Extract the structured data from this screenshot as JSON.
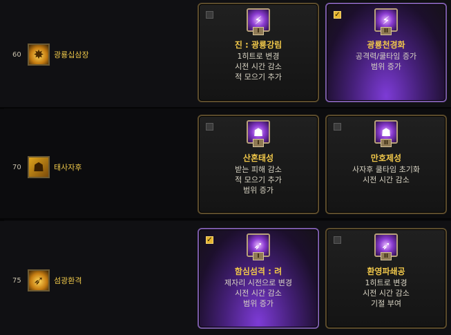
{
  "rows": [
    {
      "level": "60",
      "skill_name": "광룡십삼장",
      "skill_icon": "fire-dragon-fist-icon",
      "tripods": [
        {
          "checked": false,
          "roman": "I",
          "name": "진 : 광룡강림",
          "desc": [
            "1히트로 변경",
            "시전 시간 감소",
            "적 모으기 추가"
          ],
          "icon": "lightning-burst-icon"
        },
        {
          "checked": true,
          "roman": "II",
          "name": "광룡천경화",
          "desc": [
            "공격력/쿨타임 증가",
            "범위 증가"
          ],
          "icon": "lightning-burst-icon"
        }
      ]
    },
    {
      "level": "70",
      "skill_name": "태사자후",
      "skill_icon": "tiger-roar-icon",
      "tripods": [
        {
          "checked": false,
          "roman": "I",
          "name": "산혼태성",
          "desc": [
            "받는 피해 감소",
            "적 모으기 추가",
            "범위 증가"
          ],
          "icon": "tiger-mask-icon"
        },
        {
          "checked": false,
          "roman": "II",
          "name": "만호제성",
          "desc": [
            "사자후 쿨타임 초기화",
            "시전 시간 감소"
          ],
          "icon": "tiger-mask-icon"
        }
      ]
    },
    {
      "level": "75",
      "skill_name": "섬광환격",
      "skill_icon": "flash-strike-icon",
      "tripods": [
        {
          "checked": true,
          "roman": "I",
          "name": "함심섬격 : 려",
          "desc": [
            "제자리 시전으로 변경",
            "시전 시간 감소",
            "범위 증가"
          ],
          "icon": "dash-strike-icon"
        },
        {
          "checked": false,
          "roman": "II",
          "name": "환영파쇄공",
          "desc": [
            "1히트로 변경",
            "시전 시간 감소",
            "기절 부여"
          ],
          "icon": "dash-strike-icon"
        }
      ]
    }
  ],
  "colors": {
    "name_gold": "#f1c84a",
    "desc": "#d9d4c4",
    "selected_purple": "#7d3bd6",
    "check_gold": "#e5b431"
  }
}
